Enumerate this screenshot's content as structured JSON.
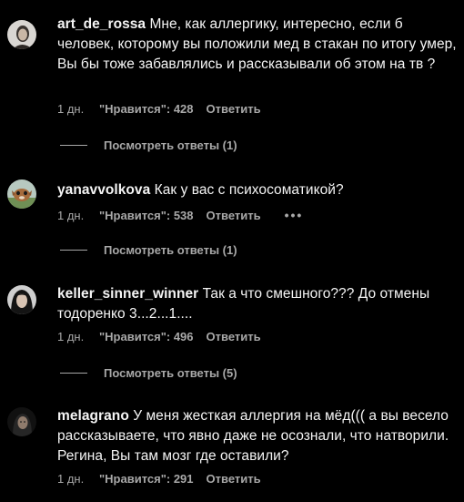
{
  "comments": [
    {
      "username": "art_de_rossa",
      "text": "Мне, как аллергику, интересно, если б человек, которому вы положили мед в стакан по итогу умер, Вы бы тоже забавлялись и рассказывали об этом на тв ?",
      "time": "1 дн.",
      "likes": "\"Нравится\": 428",
      "reply": "Ответить",
      "view_replies": "Посмотреть ответы (1)"
    },
    {
      "username": "yanavvolkova",
      "text": "Как у вас с психосоматикой?",
      "time": "1 дн.",
      "likes": "\"Нравится\": 538",
      "reply": "Ответить",
      "more": "•••",
      "view_replies": "Посмотреть ответы (1)"
    },
    {
      "username": "keller_sinner_winner",
      "text": "Так а что смешного??? До отмены тодоренко 3...2...1....",
      "time": "1 дн.",
      "likes": "\"Нравится\": 496",
      "reply": "Ответить",
      "view_replies": "Посмотреть ответы (5)"
    },
    {
      "username": "melagrano",
      "text": "У меня жесткая аллергия на мёд((( а вы весело рассказываете, что явно даже не осознали, что натворили. Регина, Вы там мозг где оставили?",
      "time": "1 дн.",
      "likes": "\"Нравится\": 291",
      "reply": "Ответить"
    }
  ],
  "colors": {
    "background": "#000000",
    "text": "#f5f5f5",
    "secondary": "#a8a8a8"
  }
}
